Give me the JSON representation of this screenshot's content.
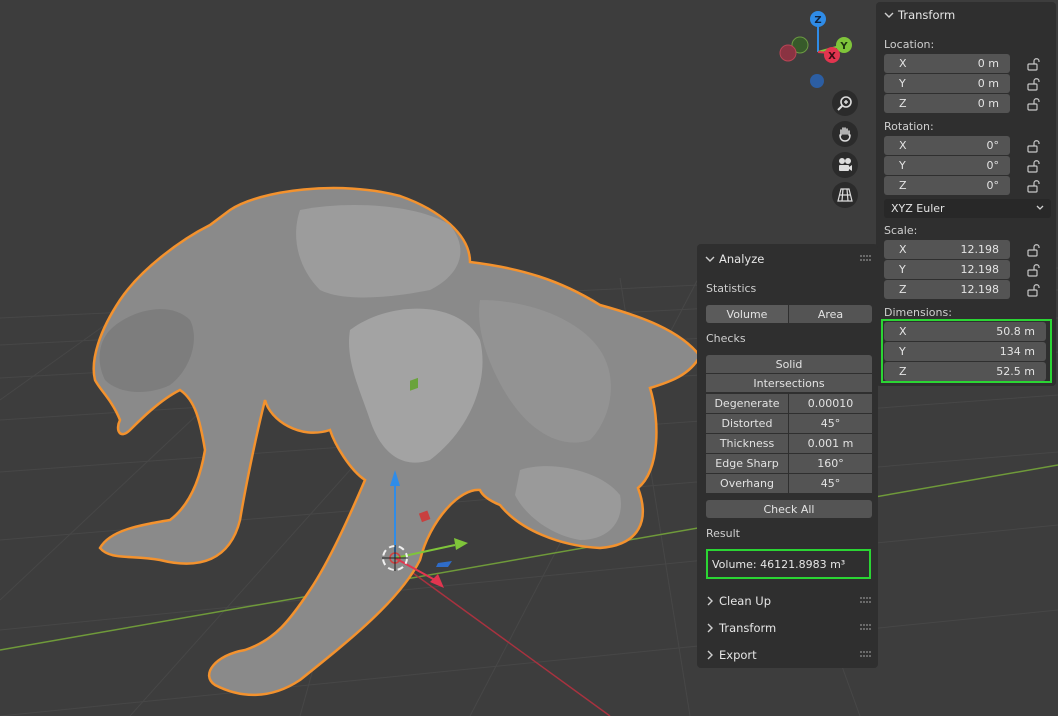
{
  "gizmo": {
    "z": "Z",
    "y": "Y",
    "x": "X"
  },
  "transform": {
    "title": "Transform",
    "location_label": "Location:",
    "location": [
      {
        "axis": "X",
        "value": "0 m"
      },
      {
        "axis": "Y",
        "value": "0 m"
      },
      {
        "axis": "Z",
        "value": "0 m"
      }
    ],
    "rotation_label": "Rotation:",
    "rotation": [
      {
        "axis": "X",
        "value": "0°"
      },
      {
        "axis": "Y",
        "value": "0°"
      },
      {
        "axis": "Z",
        "value": "0°"
      }
    ],
    "rotation_mode": "XYZ Euler",
    "scale_label": "Scale:",
    "scale": [
      {
        "axis": "X",
        "value": "12.198"
      },
      {
        "axis": "Y",
        "value": "12.198"
      },
      {
        "axis": "Z",
        "value": "12.198"
      }
    ],
    "dimensions_label": "Dimensions:",
    "dimensions": [
      {
        "axis": "X",
        "value": "50.8 m"
      },
      {
        "axis": "Y",
        "value": "134 m"
      },
      {
        "axis": "Z",
        "value": "52.5 m"
      }
    ]
  },
  "analyze": {
    "title": "Analyze",
    "statistics_label": "Statistics",
    "stat_buttons": [
      "Volume",
      "Area"
    ],
    "checks_label": "Checks",
    "solid": "Solid",
    "intersections": "Intersections",
    "checks": [
      {
        "label": "Degenerate",
        "value": "0.00010"
      },
      {
        "label": "Distorted",
        "value": "45°"
      },
      {
        "label": "Thickness",
        "value": "0.001 m"
      },
      {
        "label": "Edge Sharp",
        "value": "160°"
      },
      {
        "label": "Overhang",
        "value": "45°"
      }
    ],
    "check_all": "Check All",
    "result_label": "Result",
    "result": "Volume: 46121.8983 m³"
  },
  "collapsed_panels": [
    "Clean Up",
    "Transform",
    "Export"
  ],
  "colors": {
    "selection_outline": "#f3922e",
    "highlight": "#2bd534",
    "x_axis": "#e2354f",
    "y_axis": "#7fc53a",
    "z_axis": "#2f8ce8"
  }
}
